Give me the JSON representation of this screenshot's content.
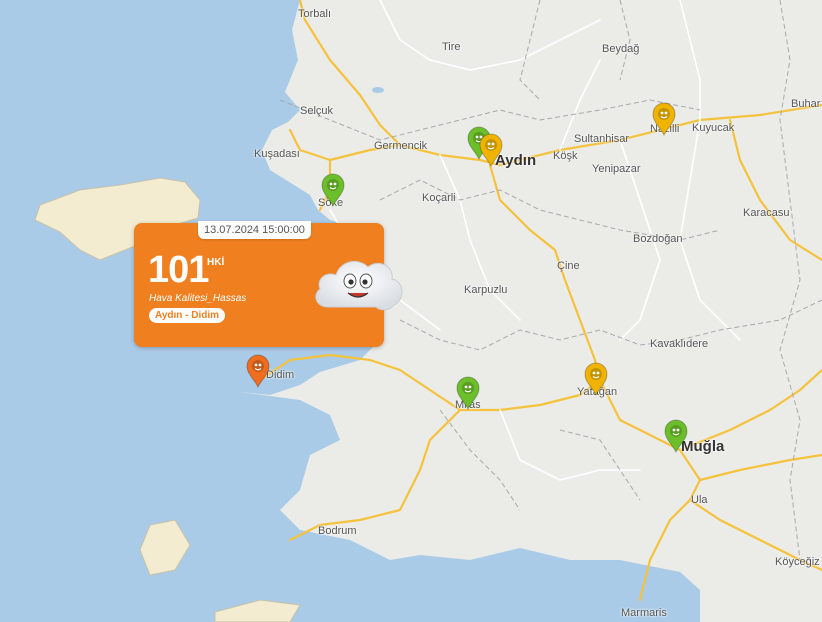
{
  "places": [
    {
      "name": "Torbalı",
      "big": false
    },
    {
      "name": "Tire",
      "big": false
    },
    {
      "name": "Beydağ",
      "big": false
    },
    {
      "name": "Selçuk",
      "big": false
    },
    {
      "name": "Germencik",
      "big": false
    },
    {
      "name": "Kuşadası",
      "big": false
    },
    {
      "name": "Aydın",
      "big": true
    },
    {
      "name": "Sultanhisar",
      "big": false
    },
    {
      "name": "Nazilli",
      "big": false
    },
    {
      "name": "Kuyucak",
      "big": false
    },
    {
      "name": "Buhar",
      "big": false
    },
    {
      "name": "Köşk",
      "big": false
    },
    {
      "name": "Yenipazar",
      "big": false
    },
    {
      "name": "Söke",
      "big": false
    },
    {
      "name": "Koçarli",
      "big": false
    },
    {
      "name": "Karacasu",
      "big": false
    },
    {
      "name": "Bozdoğan",
      "big": false
    },
    {
      "name": "Çine",
      "big": false
    },
    {
      "name": "Karpuzlu",
      "big": false
    },
    {
      "name": "Kavaklıdere",
      "big": false
    },
    {
      "name": "Didim",
      "big": false
    },
    {
      "name": "Milas",
      "big": false
    },
    {
      "name": "Yatağan",
      "big": false
    },
    {
      "name": "Muğla",
      "big": true
    },
    {
      "name": "Ula",
      "big": false
    },
    {
      "name": "Bodrum",
      "big": false
    },
    {
      "name": "Köyceğiz",
      "big": false
    },
    {
      "name": "Marmaris",
      "big": false
    }
  ],
  "markers": [
    {
      "station": "Aydın",
      "color": "#6cbf2a"
    },
    {
      "station": "Aydın 2",
      "color": "#f0b400"
    },
    {
      "station": "Nazilli",
      "color": "#f0b400"
    },
    {
      "station": "Söke",
      "color": "#6cbf2a"
    },
    {
      "station": "Didim",
      "color": "#ef6d1f"
    },
    {
      "station": "Milas",
      "color": "#6cbf2a"
    },
    {
      "station": "Yatağan",
      "color": "#f0b400"
    },
    {
      "station": "Muğla",
      "color": "#6cbf2a"
    }
  ],
  "popup": {
    "timestamp": "13.07.2024 15:00:00",
    "value": "101",
    "unit": "HKİ",
    "label": "Hava Kalitesi_Hassas",
    "station": "Aydın - Didim",
    "color": "#ef7f1f"
  },
  "colors": {
    "sea": "#aacbe8",
    "land": "#ebebe8",
    "road_major": "#f5c23c",
    "road_minor": "#ffffff",
    "border": "#9a9a9a",
    "island": "#f3ecd0"
  }
}
